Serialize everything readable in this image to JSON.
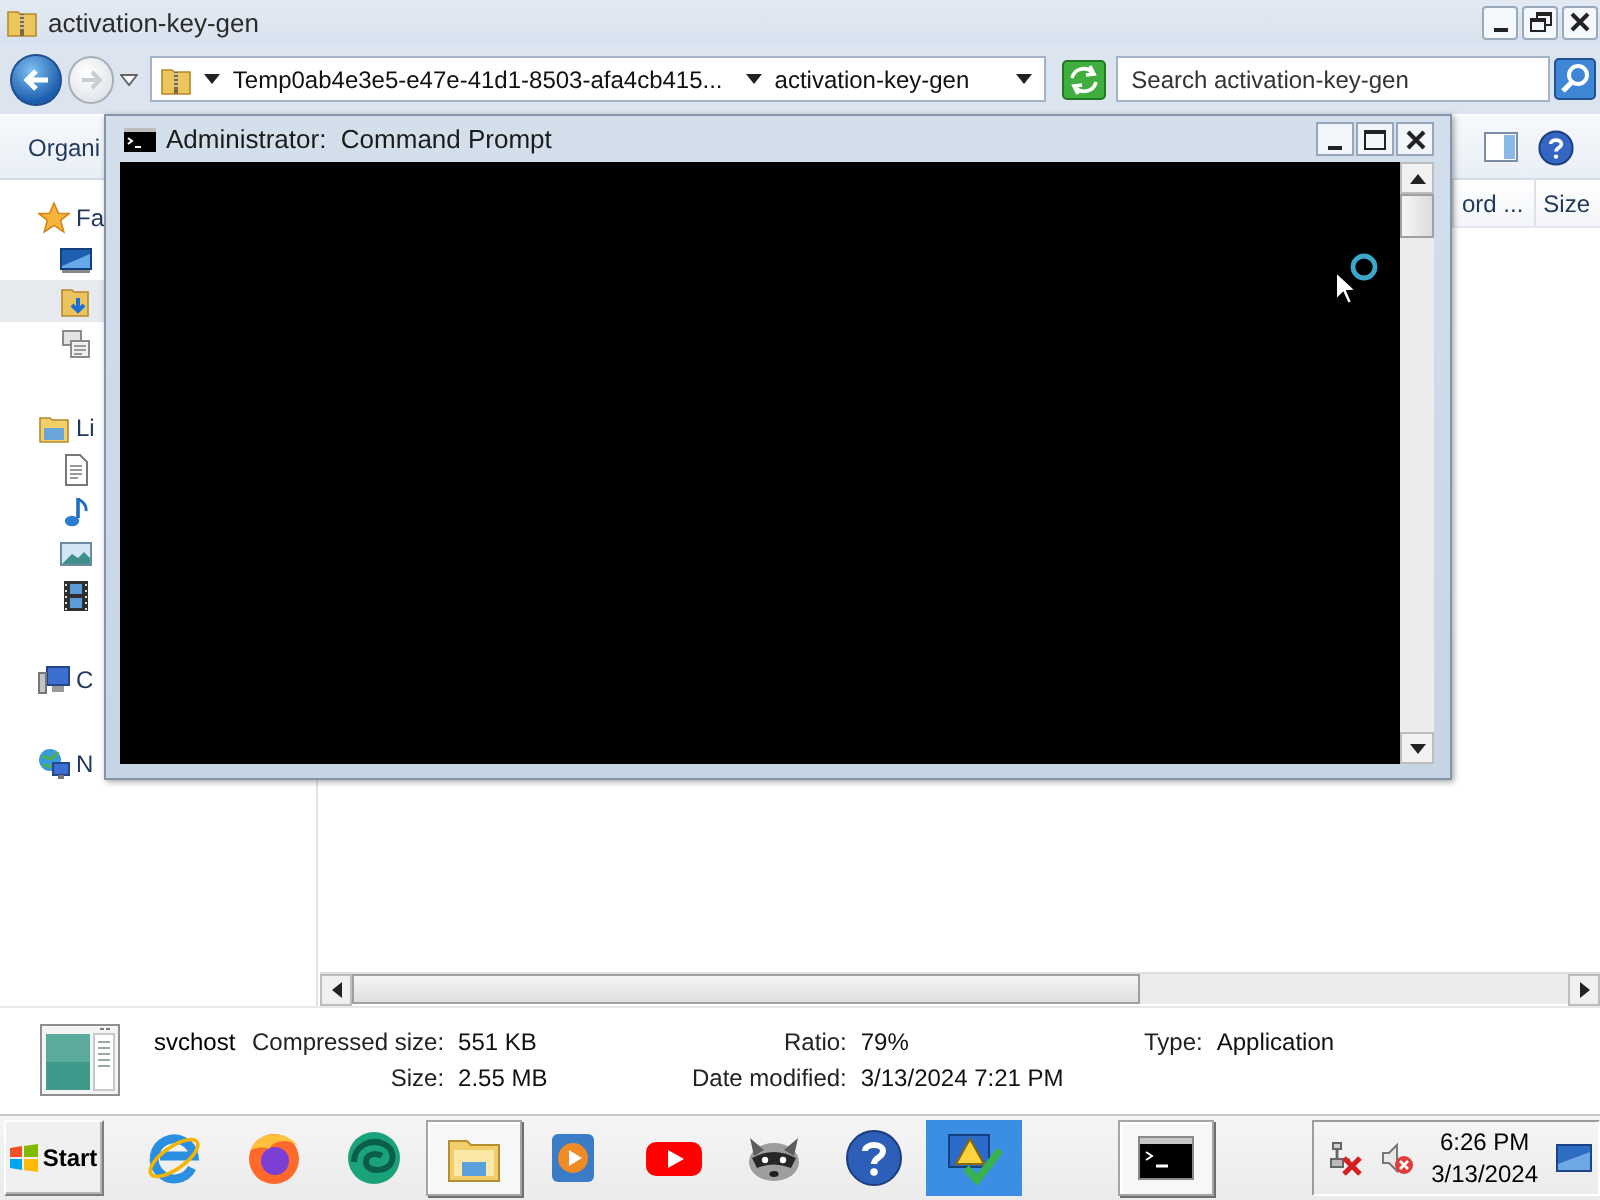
{
  "explorer": {
    "title": "activation-key-gen",
    "nav": {
      "back_disabled": false,
      "forward_disabled": true
    },
    "breadcrumb": [
      "Temp0ab4e3e5-e47e-41d1-8503-afa4cb415...",
      "activation-key-gen"
    ],
    "search": {
      "placeholder": "Search activation-key-gen"
    },
    "toolbar": {
      "organize": "Organi"
    },
    "sidebar": [
      {
        "label": "Fa",
        "kind": "favorites",
        "selected": false,
        "children": [
          {
            "kind": "desktop",
            "selected": false
          },
          {
            "kind": "downloads",
            "selected": true
          },
          {
            "kind": "recent",
            "selected": false
          }
        ]
      },
      {
        "label": "Li",
        "kind": "libraries",
        "selected": false,
        "children": [
          {
            "kind": "documents",
            "selected": false
          },
          {
            "kind": "music",
            "selected": false
          },
          {
            "kind": "pictures",
            "selected": false
          },
          {
            "kind": "videos",
            "selected": false
          }
        ]
      },
      {
        "label": "C",
        "kind": "computer",
        "selected": false
      },
      {
        "label": "N",
        "kind": "network",
        "selected": false
      }
    ],
    "columns": [
      "ord ...",
      "Size"
    ],
    "details": {
      "name": "svchost",
      "columns": [
        [
          {
            "label": "Compressed size:",
            "value": "551 KB"
          },
          {
            "label": "Size:",
            "value": "2.55 MB"
          }
        ],
        [
          {
            "label": "Ratio:",
            "value": "79%"
          },
          {
            "label": "Date modified:",
            "value": "3/13/2024 7:21 PM"
          }
        ],
        [
          {
            "label": "Type:",
            "value": "Application"
          }
        ]
      ]
    }
  },
  "console": {
    "title": "Administrator:  Command Prompt"
  },
  "taskbar": {
    "start": "Start",
    "pinned": [
      {
        "kind": "ie",
        "open": false,
        "highlighted": false
      },
      {
        "kind": "firefox",
        "open": false,
        "highlighted": false
      },
      {
        "kind": "edge",
        "open": false,
        "highlighted": false
      },
      {
        "kind": "explorer",
        "open": true,
        "highlighted": false
      },
      {
        "kind": "media",
        "open": false,
        "highlighted": false
      },
      {
        "kind": "youtube",
        "open": false,
        "highlighted": false
      },
      {
        "kind": "raccoon",
        "open": false,
        "highlighted": false
      },
      {
        "kind": "help",
        "open": false,
        "highlighted": false
      },
      {
        "kind": "action-center",
        "open": false,
        "highlighted": true
      }
    ],
    "running": [
      {
        "kind": "cmd",
        "open": true,
        "highlighted": false
      }
    ],
    "tray": {
      "network_connected": false,
      "muted": true,
      "time": "6:26 PM",
      "date": "3/13/2024"
    }
  }
}
